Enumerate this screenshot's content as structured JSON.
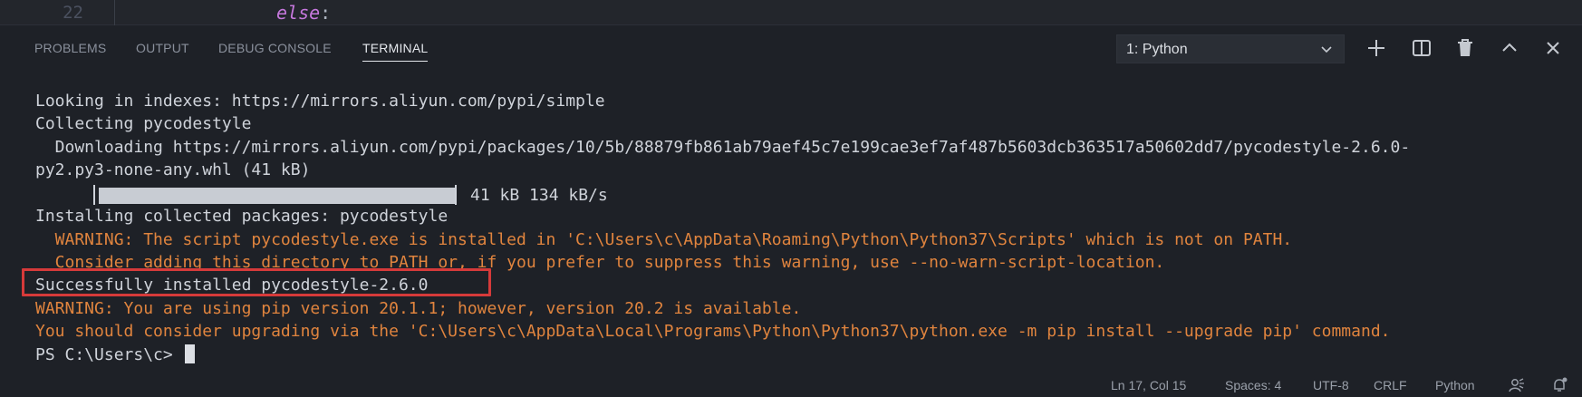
{
  "editor": {
    "line_number": "22",
    "code_keyword": "else",
    "code_colon": ":"
  },
  "panel": {
    "tabs": [
      {
        "label": "PROBLEMS",
        "active": false
      },
      {
        "label": "OUTPUT",
        "active": false
      },
      {
        "label": "DEBUG CONSOLE",
        "active": false
      },
      {
        "label": "TERMINAL",
        "active": true
      }
    ],
    "terminal_select": {
      "value": "1: Python"
    },
    "icons": [
      "chevron-down-icon",
      "plus-icon",
      "split-terminal-icon",
      "trash-icon",
      "maximize-panel-icon",
      "close-icon"
    ]
  },
  "terminal": {
    "lines": [
      {
        "text": "Looking in indexes: https://mirrors.aliyun.com/pypi/simple",
        "kind": "normal"
      },
      {
        "text": "Collecting pycodestyle",
        "kind": "normal"
      },
      {
        "text": "  Downloading https://mirrors.aliyun.com/pypi/packages/10/5b/88879fb861ab79aef45c7e199cae3ef7af487b5603dcb363517a50602dd7/pycodestyle-2.6.0-",
        "kind": "normal"
      },
      {
        "text": "py2.py3-none-any.whl (41 kB)",
        "kind": "normal"
      },
      {
        "text": "",
        "kind": "progress"
      },
      {
        "text": "Installing collected packages: pycodestyle",
        "kind": "normal"
      },
      {
        "text": "  WARNING: The script pycodestyle.exe is installed in 'C:\\Users\\c\\AppData\\Roaming\\Python\\Python37\\Scripts' which is not on PATH.",
        "kind": "warn"
      },
      {
        "text": "  Consider adding this directory to PATH or, if you prefer to suppress this warning, use --no-warn-script-location.",
        "kind": "warn"
      },
      {
        "text": "Successfully installed pycodestyle-2.6.0",
        "kind": "normal"
      },
      {
        "text": "WARNING: You are using pip version 20.1.1; however, version 20.2 is available.",
        "kind": "warn"
      },
      {
        "text": "You should consider upgrading via the 'C:\\Users\\c\\AppData\\Local\\Programs\\Python\\Python37\\python.exe -m pip install --upgrade pip' command.",
        "kind": "warn"
      },
      {
        "text": "PS C:\\Users\\c> ",
        "kind": "prompt"
      }
    ],
    "progress": {
      "fraction": 1.0,
      "text": "41 kB 134 kB/s"
    },
    "highlighted_line": "Successfully installed pycodestyle-2.6.0"
  },
  "status_bar": {
    "position": "Ln 17, Col 15",
    "spaces": "Spaces: 4",
    "encoding": "UTF-8",
    "eol": "CRLF",
    "language": "Python",
    "icons": [
      "feedback-icon",
      "notifications-bell-icon"
    ]
  },
  "colors": {
    "background": "#1e2127",
    "warning_text": "#e0843e",
    "highlight_box": "#d63a3a",
    "keyword": "#c678dd"
  }
}
